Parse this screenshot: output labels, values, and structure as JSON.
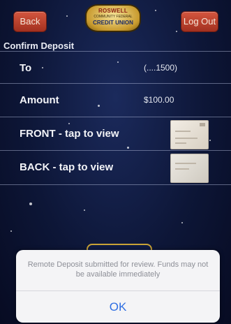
{
  "header": {
    "back_label": "Back",
    "logout_label": "Log Out",
    "logo": {
      "line1": "ROSWELL",
      "line2": "COMMUNITY FEDERAL",
      "line3": "CREDIT UNION"
    }
  },
  "confirm": {
    "title": "Confirm Deposit",
    "rows": [
      {
        "label": "To",
        "value": "(....1500)"
      },
      {
        "label": "Amount",
        "value": "$100.00"
      },
      {
        "label": "FRONT - tap to view",
        "thumb": "check-front-thumbnail"
      },
      {
        "label": "BACK - tap to view",
        "thumb": "check-back-thumbnail"
      }
    ]
  },
  "alert": {
    "message": "Remote Deposit submitted for review. Funds may not be available immediately",
    "ok_label": "OK"
  },
  "colors": {
    "background": "#0d1637",
    "header_button": "#c0412c",
    "logo_gold": "#c89a2e",
    "alert_ok": "#2f6ee2",
    "alert_text": "#8d8f97"
  }
}
